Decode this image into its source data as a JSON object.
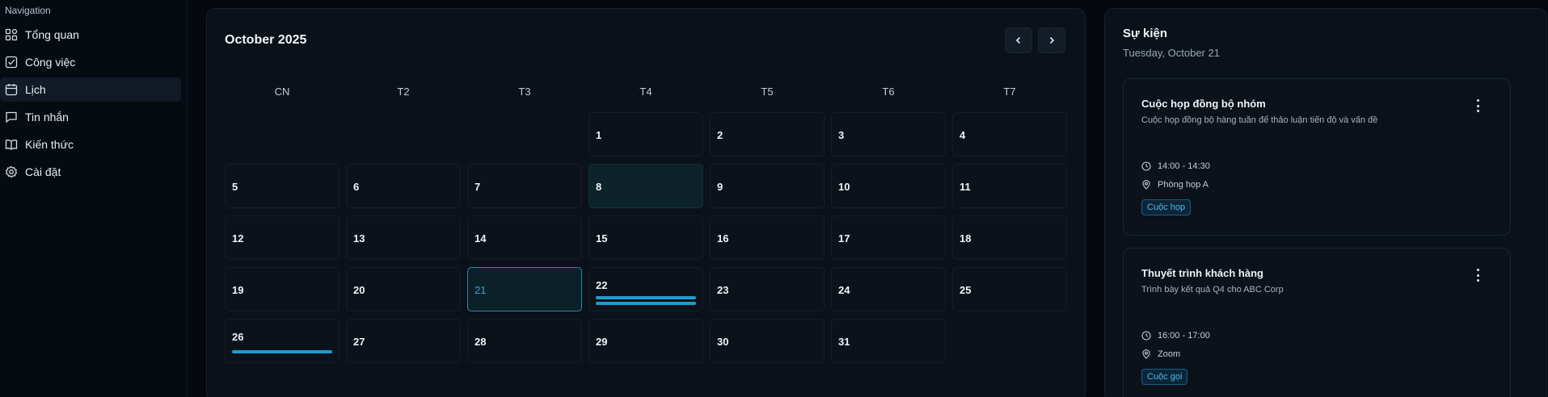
{
  "sidebar": {
    "heading": "Navigation",
    "items": [
      {
        "label": "Tổng quan",
        "icon": "dashboard-icon"
      },
      {
        "label": "Công việc",
        "icon": "task-check-icon"
      },
      {
        "label": "Lịch",
        "icon": "calendar-icon",
        "active": true
      },
      {
        "label": "Tin nhắn",
        "icon": "message-icon"
      },
      {
        "label": "Kiến thức",
        "icon": "book-icon"
      },
      {
        "label": "Cài đặt",
        "icon": "gear-icon"
      }
    ]
  },
  "calendar": {
    "month_label": "October 2025",
    "prev_icon": "chevron-left-icon",
    "next_icon": "chevron-right-icon",
    "weekdays": [
      "CN",
      "T2",
      "T3",
      "T4",
      "T5",
      "T6",
      "T7"
    ],
    "days": [
      {
        "n": "1"
      },
      {
        "n": "2"
      },
      {
        "n": "3"
      },
      {
        "n": "4"
      },
      {
        "n": "5"
      },
      {
        "n": "6"
      },
      {
        "n": "7"
      },
      {
        "n": "8",
        "highlight": true
      },
      {
        "n": "9"
      },
      {
        "n": "10"
      },
      {
        "n": "11"
      },
      {
        "n": "12"
      },
      {
        "n": "13"
      },
      {
        "n": "14"
      },
      {
        "n": "15"
      },
      {
        "n": "16"
      },
      {
        "n": "17"
      },
      {
        "n": "18"
      },
      {
        "n": "19"
      },
      {
        "n": "20"
      },
      {
        "n": "21",
        "today": true
      },
      {
        "n": "22",
        "events": 2
      },
      {
        "n": "23"
      },
      {
        "n": "24"
      },
      {
        "n": "25"
      },
      {
        "n": "26",
        "events": 1
      },
      {
        "n": "27"
      },
      {
        "n": "28"
      },
      {
        "n": "29"
      },
      {
        "n": "30"
      },
      {
        "n": "31"
      }
    ],
    "first_weekday": 3,
    "accent_color": "#1d9bd1"
  },
  "events_panel": {
    "title": "Sự kiện",
    "date": "Tuesday, October 21",
    "events": [
      {
        "title": "Cuộc họp đồng bộ nhóm",
        "description": "Cuộc họp đồng bộ hàng tuần để thảo luận tiến độ và vấn đề",
        "time": "14:00 - 14:30",
        "location": "Phòng họp A",
        "tag": "Cuộc họp"
      },
      {
        "title": "Thuyết trình khách hàng",
        "description": "Trình bày kết quả Q4 cho ABC Corp",
        "time": "16:00 - 17:00",
        "location": "Zoom",
        "tag": "Cuộc gọi"
      }
    ]
  }
}
